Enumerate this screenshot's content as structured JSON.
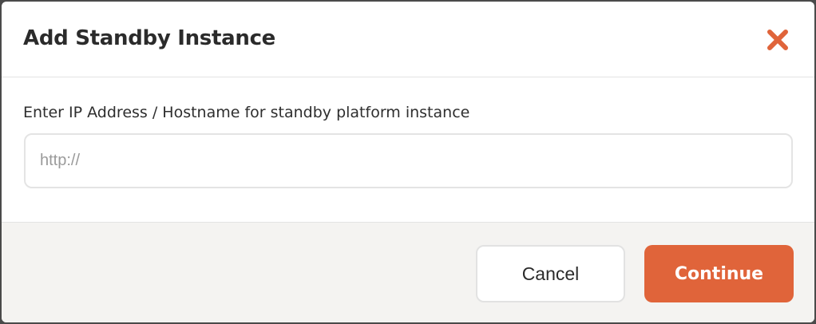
{
  "dialog": {
    "title": "Add Standby Instance",
    "close_icon": "close-icon",
    "field_label": "Enter IP Address / Hostname for standby platform instance",
    "input_value": "",
    "input_placeholder": "http://",
    "cancel_label": "Cancel",
    "continue_label": "Continue"
  },
  "colors": {
    "accent": "#e0643a",
    "footer_bg": "#f4f3f1",
    "title_text": "#2b2b2b"
  }
}
